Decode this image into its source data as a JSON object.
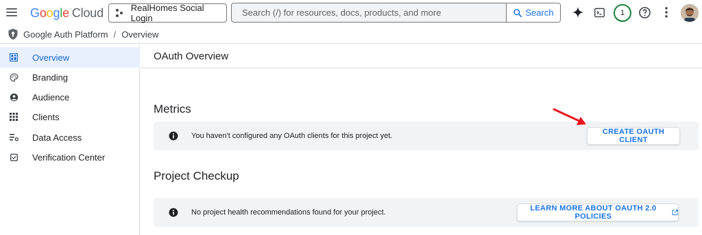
{
  "header": {
    "logo_google": "Google",
    "logo_cloud": "Cloud",
    "project_name": "RealHomes Social Login",
    "search_placeholder": "Search (/) for resources, docs, products, and more",
    "search_button": "Search",
    "notification_count": "1"
  },
  "breadcrumb": {
    "product": "Google Auth Platform",
    "separator": "/",
    "page": "Overview"
  },
  "sidebar": {
    "items": [
      {
        "label": "Overview",
        "icon": "dashboard-icon",
        "active": true
      },
      {
        "label": "Branding",
        "icon": "palette-icon",
        "active": false
      },
      {
        "label": "Audience",
        "icon": "person-icon",
        "active": false
      },
      {
        "label": "Clients",
        "icon": "grid-icon",
        "active": false
      },
      {
        "label": "Data Access",
        "icon": "list-filter-icon",
        "active": false
      },
      {
        "label": "Verification Center",
        "icon": "checkbox-icon",
        "active": false
      }
    ]
  },
  "main": {
    "title": "OAuth Overview",
    "metrics": {
      "heading": "Metrics",
      "message": "You haven't configured any OAuth clients for this project yet.",
      "button": "CREATE OAUTH CLIENT"
    },
    "checkup": {
      "heading": "Project Checkup",
      "message": "No project health recommendations found for your project.",
      "button": "LEARN MORE ABOUT OAUTH 2.0 POLICIES"
    }
  },
  "colors": {
    "accent": "#1a73e8",
    "active_bg": "#e8f0fe",
    "banner_bg": "#f1f3f4",
    "annotation_arrow": "#e8141c"
  }
}
